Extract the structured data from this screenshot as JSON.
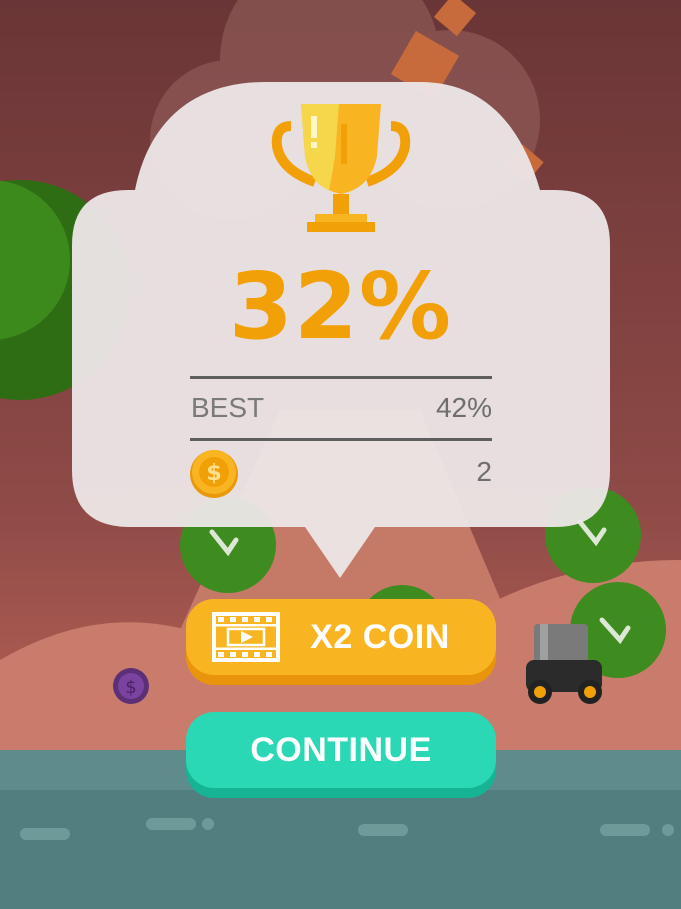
{
  "result": {
    "percent": "32%",
    "best_label": "BEST",
    "best_value": "42%",
    "coins": "2"
  },
  "buttons": {
    "x2_coin_label": "X2 COIN",
    "continue_label": "CONTINUE"
  },
  "icons": {
    "trophy": "trophy-icon",
    "coin": "coin-icon",
    "video": "video-film-icon"
  },
  "colors": {
    "sky": "#6E3738",
    "panel": "#EDE7E8",
    "percent": "#F2A007",
    "x2_button": "#F8B521",
    "continue_button": "#2BD8B6",
    "water": "#4E7F84"
  }
}
